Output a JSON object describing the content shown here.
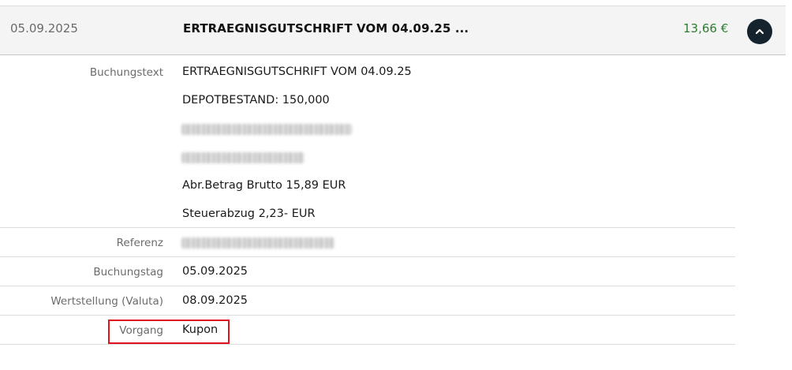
{
  "header": {
    "date": "05.09.2025",
    "title": "ERTRAEGNISGUTSCHRIFT VOM 04.09.25 ...",
    "amount": "13,66 €",
    "amount_color": "#2e7d32",
    "collapse_icon": "chevron-up-icon"
  },
  "details": {
    "buchungstext_label": "Buchungstext",
    "buchungstext_lines": [
      "ERTRAEGNISGUTSCHRIFT VOM 04.09.25",
      "DEPOTBESTAND: 150,000",
      "Abr.Betrag Brutto 15,89 EUR",
      "Steuerabzug 2,23- EUR"
    ],
    "referenz_label": "Referenz",
    "buchungstag_label": "Buchungstag",
    "buchungstag_value": "05.09.2025",
    "wertstellung_label": "Wertstellung (Valuta)",
    "wertstellung_value": "08.09.2025",
    "vorgang_label": "Vorgang",
    "vorgang_value": "Kupon"
  },
  "colors": {
    "highlight": "#e0141e",
    "button_bg": "#14232e"
  }
}
